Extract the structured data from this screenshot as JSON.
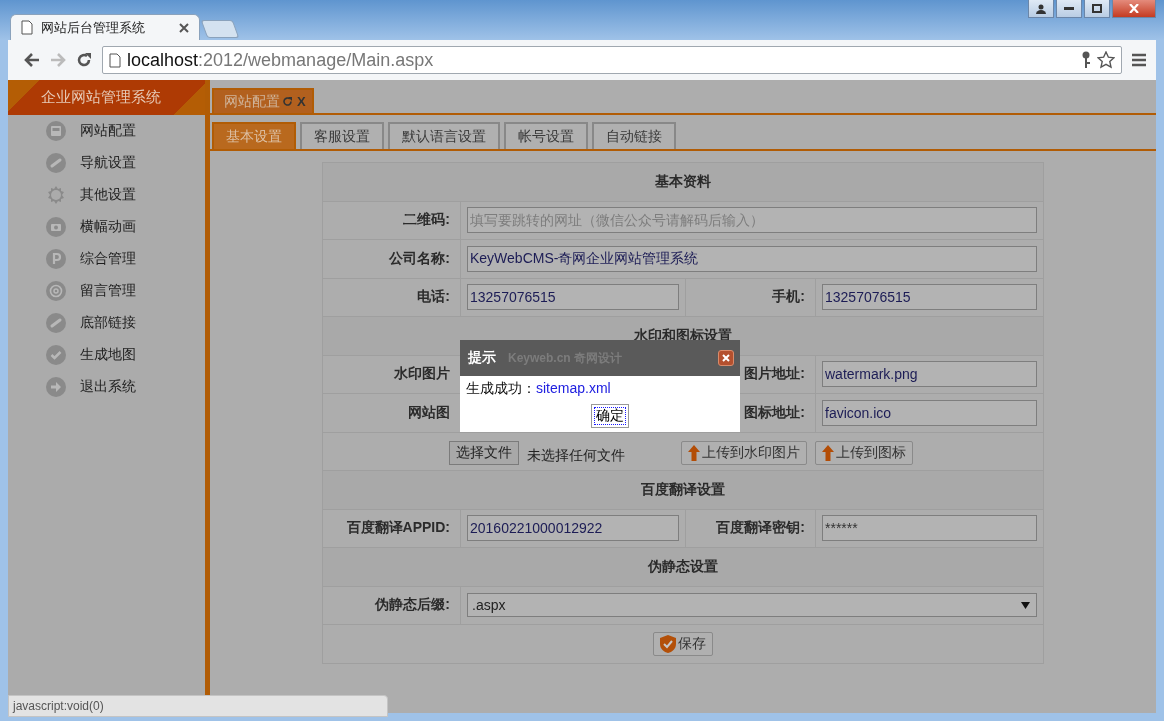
{
  "browser": {
    "tab_title": "网站后台管理系统",
    "url_host": "localhost",
    "url_rest": ":2012/webmanage/Main.aspx"
  },
  "sidebar": {
    "title": "企业网站管理系统",
    "items": [
      {
        "label": "网站配置"
      },
      {
        "label": "导航设置"
      },
      {
        "label": "其他设置"
      },
      {
        "label": "横幅动画"
      },
      {
        "label": "综合管理"
      },
      {
        "label": "留言管理"
      },
      {
        "label": "底部链接"
      },
      {
        "label": "生成地图"
      },
      {
        "label": "退出系统"
      }
    ]
  },
  "page_tabs": [
    {
      "label": "网站配置",
      "close": "X",
      "selected": true
    }
  ],
  "sub_tabs": [
    {
      "label": "基本设置",
      "selected": true
    },
    {
      "label": "客服设置",
      "selected": false
    },
    {
      "label": "默认语言设置",
      "selected": false
    },
    {
      "label": "帐号设置",
      "selected": false
    },
    {
      "label": "自动链接",
      "selected": false
    }
  ],
  "form": {
    "rows": [
      {
        "kind": "section",
        "title": "基本资料"
      },
      {
        "kind": "full",
        "label": "二维码:",
        "placeholder": "填写要跳转的网址（微信公众号请解码后输入）"
      },
      {
        "kind": "full",
        "label": "公司名称:",
        "value": "KeyWebCMS-奇网企业网站管理系统"
      },
      {
        "kind": "pair",
        "label": "电话:",
        "value": "13257076515",
        "label2": "手机:",
        "value2": "13257076515"
      },
      {
        "kind": "section",
        "title": "水印和图标设置"
      },
      {
        "kind": "pair",
        "label": "水印图片",
        "label2": "图片地址:",
        "value2": "watermark.png"
      },
      {
        "kind": "pair",
        "label": "网站图",
        "label2": "图标地址:",
        "value2": "favicon.ico"
      },
      {
        "kind": "upload",
        "file_button": "选择文件",
        "file_status": "未选择任何文件",
        "buttons": [
          "上传到水印图片",
          "上传到图标"
        ]
      },
      {
        "kind": "section",
        "title": "百度翻译设置"
      },
      {
        "kind": "pair",
        "label": "百度翻译APPID:",
        "value": "20160221000012922",
        "label2": "百度翻译密钥:",
        "value2": "******"
      },
      {
        "kind": "section",
        "title": "伪静态设置"
      },
      {
        "kind": "select",
        "label": "伪静态后缀:",
        "value": ".aspx"
      },
      {
        "kind": "actions",
        "button": "保存"
      }
    ]
  },
  "dialog": {
    "title": "提示",
    "brand": "Keyweb.cn 奇网设计",
    "message": "生成成功：",
    "link": "sitemap.xml",
    "ok": "确定"
  },
  "status_bar": "javascript:void(0)"
}
